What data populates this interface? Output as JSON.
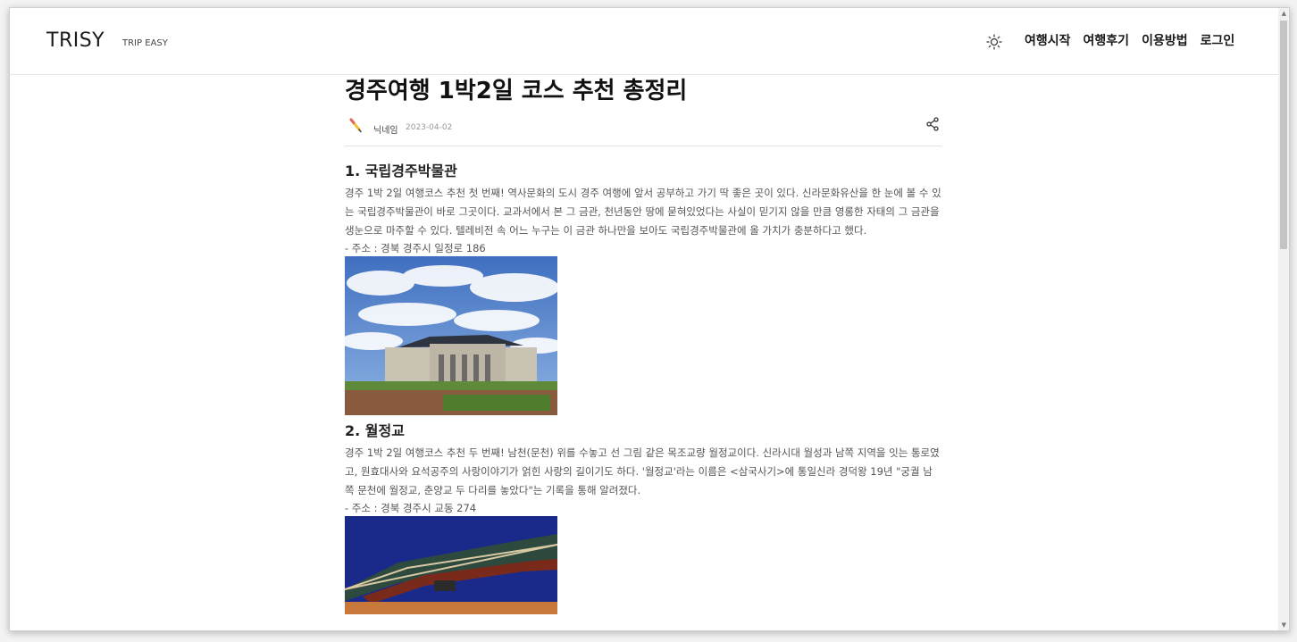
{
  "navbar": {
    "brand": "TRISY",
    "brand_sub": "TRIP EASY",
    "links": [
      "여행시작",
      "여행후기",
      "이용방법",
      "로그인"
    ]
  },
  "post": {
    "title": "경주여행 1박2일 코스 추천 총정리",
    "author": "닉네임",
    "date": "2023-04-02",
    "sections": [
      {
        "heading": "1. 국립경주박물관",
        "body": "경주 1박 2일 여행코스 추천 첫 번째! 역사문화의 도시 경주 여행에 앞서 공부하고 가기 딱 좋은 곳이 있다. 신라문화유산을 한 눈에 볼 수 있는 국립경주박물관이 바로 그곳이다. 교과서에서 본 그 금관, 천년동안 땅에 묻혀있었다는 사실이 믿기지 않을 만큼 영롱한 자태의 그 금관을 생눈으로 마주할 수 있다. 텔레비전 속 어느 누구는 이 금관 하나만을 보아도 국립경주박물관에 올 가치가 충분하다고 했다.",
        "address": "- 주소 : 경북 경주시 일정로 186"
      },
      {
        "heading": "2. 월정교",
        "body": "경주 1박 2일 여행코스 추천 두 번째! 남천(문천) 위를 수놓고 선 그림 같은 목조교량 월정교이다. 신라시대 월성과 남쪽 지역을 잇는 통로였고, 원효대사와 요석공주의 사랑이야기가 얽힌 사랑의 길이기도 하다. '월정교'라는 이름은 <삼국사기>에 통일신라 경덕왕 19년 \"궁궐 남쪽 문천에 월정교, 춘양교 두 다리를 놓았다\"는 기록을 통해 알려졌다.",
        "address": "- 주소 : 경북 경주시 교동 274"
      }
    ]
  },
  "icons": {
    "theme": "sun-icon",
    "author": "pencil-icon",
    "share": "share-icon"
  },
  "colors": {
    "sky": "#4a7fc8",
    "night_sky": "#1a2a8a",
    "text": "#555555"
  }
}
